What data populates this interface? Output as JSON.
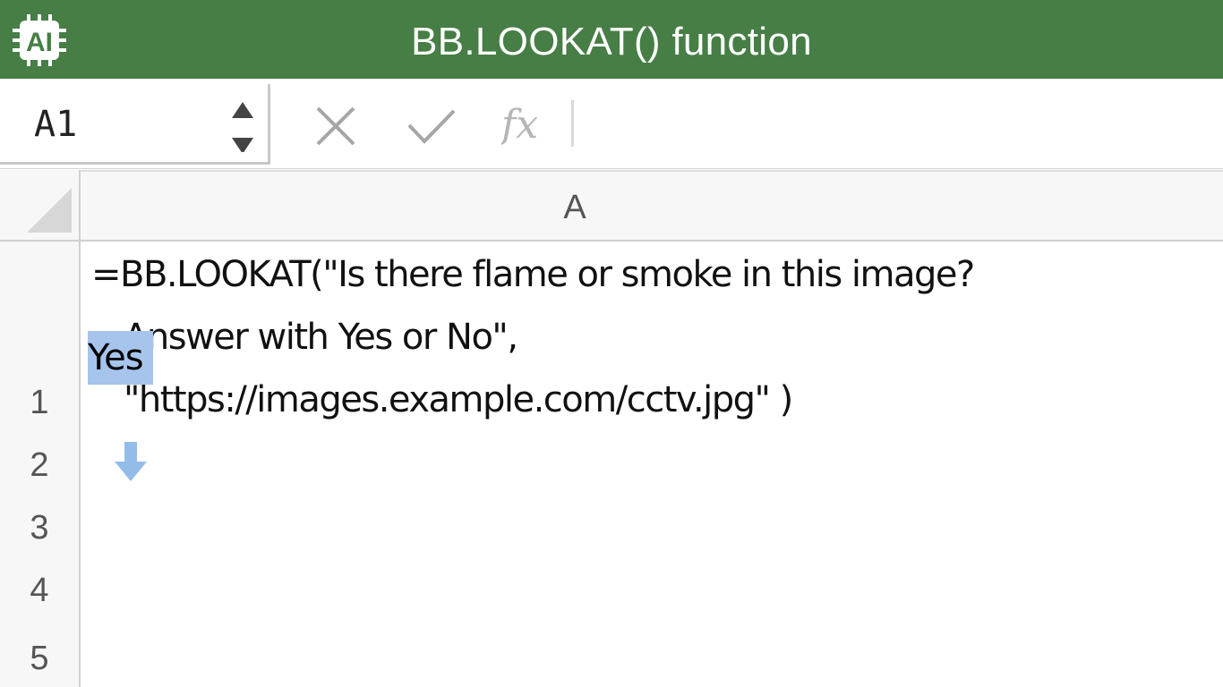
{
  "titlebar": {
    "title": "BB.LOOKAT() function",
    "app_icon": "ai-chip-icon",
    "bg": "#467e45"
  },
  "formula_bar": {
    "name_box": "A1",
    "cancel_icon": "close-icon",
    "enter_icon": "checkmark-icon",
    "function_icon": "fx-icon"
  },
  "sheet": {
    "columns": [
      "A"
    ],
    "rows": [
      "1",
      "2",
      "3",
      "4",
      "5"
    ],
    "cells": {
      "a1_line1": "=BB.LOOKAT(\"Is there flame or smoke in this image?",
      "a1_line2": "Answer with Yes or No\",",
      "a1_line3": "\"https://images.example.com/cctv.jpg\" )",
      "a2_icon": "down-arrow-icon",
      "a3": "Yes"
    },
    "accent": "#a7c5ec"
  }
}
